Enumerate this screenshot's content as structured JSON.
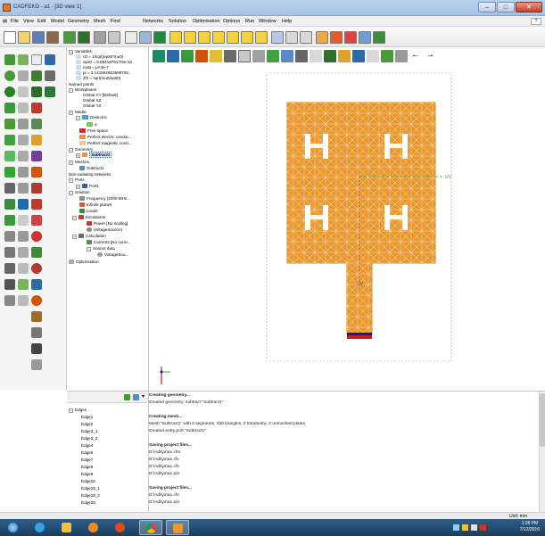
{
  "window": {
    "title": "CADFEKO - a1 - [3D view 1]",
    "minimize": "–",
    "maximize": "□",
    "close": "✕"
  },
  "menu": [
    "File",
    "View",
    "Edit",
    "Model",
    "Geometry",
    "Mesh",
    "Find",
    "Networks",
    "Solution",
    "Optimisation",
    "Options",
    "Run",
    "Window",
    "Help"
  ],
  "tree": {
    "variables_label": "Variables",
    "variables": [
      "c0 = 1/sqrt(eps0*mu0)",
      "eps0 = 8.854187817/6e-12",
      "mu0 = pi*4e-7",
      "pi = 3.141592653589793..",
      "zf0 = sqrt(mu0/eps0)"
    ],
    "named_points": "Named points",
    "workplanes_label": "Workplanes",
    "workplanes": [
      "Global XY [Default]",
      "Global XZ",
      "Global YZ"
    ],
    "media_label": "Media",
    "dielectric_label": "Dielectric",
    "dielectric_item": "a",
    "media": [
      "Free space",
      "Perfect electric conduc...",
      "Perfect magnetic cond..."
    ],
    "geometry_label": "Geometry",
    "geometry_item": "Subtract1",
    "meshes_label": "Meshes",
    "mesh_item": "Subtract1",
    "non_radiating": "Non-radiating networks",
    "ports_label": "Ports",
    "port_item": "Port1",
    "solution_label": "Solution",
    "frequency": "Frequency [1000 MHz...",
    "infinite_planes": "Infinite planes",
    "loads": "Loads",
    "excitations_label": "Excitations",
    "power": "Power [No scaling]",
    "voltage_source": "VoltageSource1",
    "calculation_label": "Calculation",
    "currents": "Currents [No curre...",
    "source_data": "Source data",
    "source_item": "VoltageSou...",
    "optimisation": "Optimisation"
  },
  "edges": {
    "root": "Edges",
    "items": [
      "Edge1",
      "Edge2",
      "Edge3_1",
      "Edge3_2",
      "Edge4",
      "Edge6",
      "Edge7",
      "Edge8",
      "Edge9",
      "Edge18",
      "Edge19_1",
      "Edge19_2",
      "Edge20"
    ]
  },
  "messages": [
    {
      "text": "Creating geometry...",
      "bold": true
    },
    {
      "text": "Created geometry: subtract \"Subtract1\"",
      "bold": false
    },
    {
      "text": "",
      "bold": false
    },
    {
      "text": "Creating mesh...",
      "bold": true
    },
    {
      "text": "Mesh \"Subtract1\" with 0 segments, 430 triangles, 0 tetrahedra, 0 unmeshed plates.",
      "bold": false
    },
    {
      "text": "Created entry port \"Subtract1\"",
      "bold": false
    },
    {
      "text": "",
      "bold": false
    },
    {
      "text": "Saving project files...",
      "bold": true
    },
    {
      "text": "D:\\Aditya\\a1.cfm",
      "bold": false
    },
    {
      "text": "D:\\Aditya\\a1.cfx",
      "bold": false
    },
    {
      "text": "D:\\Aditya\\a1.cfs",
      "bold": false
    },
    {
      "text": "D:\\Aditya\\a1.pre",
      "bold": false
    },
    {
      "text": "",
      "bold": false
    },
    {
      "text": "Saving project files...",
      "bold": true
    },
    {
      "text": "D:\\Aditya\\a1.cfs",
      "bold": false
    },
    {
      "text": "D:\\Aditya\\a1.pre",
      "bold": false
    }
  ],
  "view": {
    "axis_label": "UV",
    "patch_color": "#e8982e",
    "mesh_color": "#fbe3b8",
    "edge_color": "#d98a22",
    "axis_color": "#27ae1a",
    "port_color": "#c21d1d",
    "port_blue": "#1a1a8c",
    "feed_label": "UV"
  },
  "status": {
    "units": "Unit: mm"
  },
  "clock": {
    "time": "1:28 PM",
    "date": "7/12/2016"
  },
  "colors": {
    "taskbar": "#1b3d5e",
    "accent": "#3a5e9a"
  }
}
